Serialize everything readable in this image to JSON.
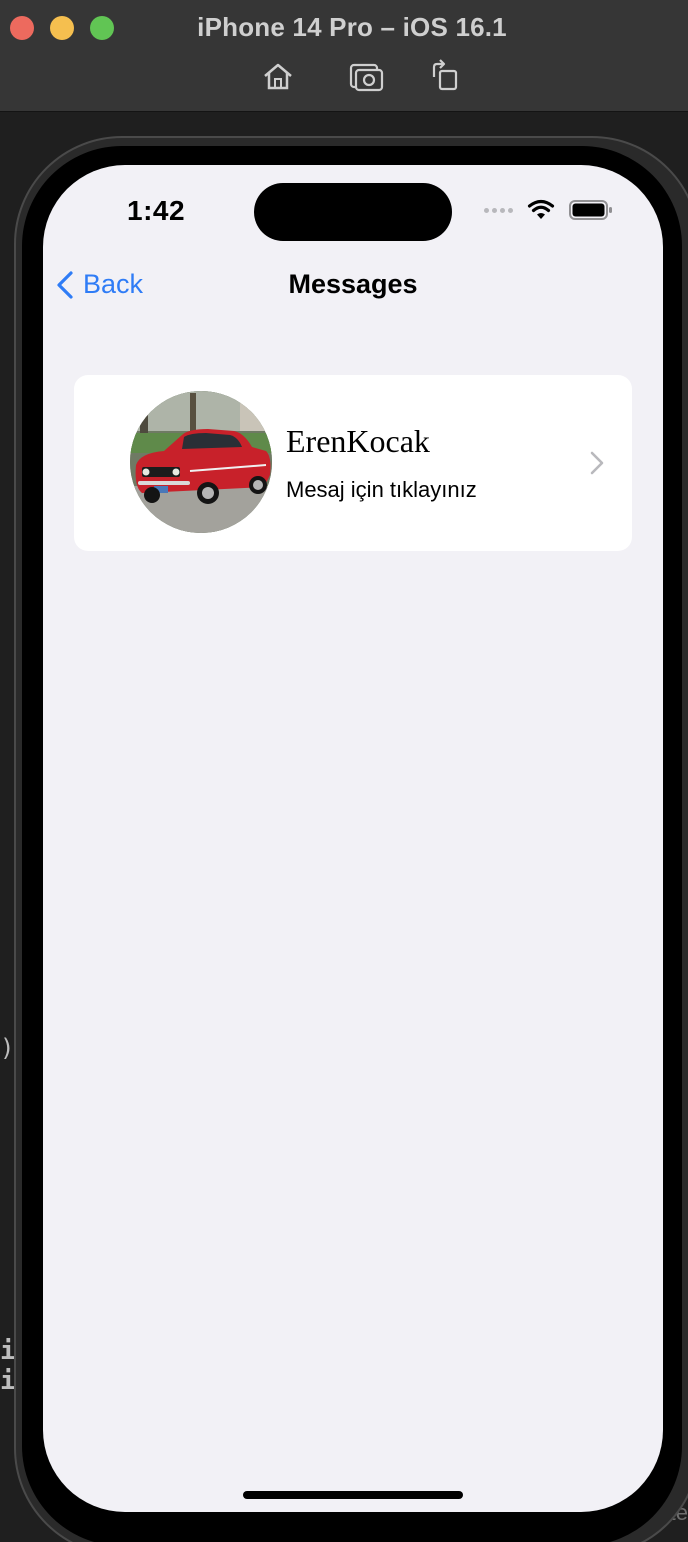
{
  "window": {
    "title": "iPhone 14 Pro – iOS 16.1",
    "controls": [
      "close",
      "minimize",
      "zoom"
    ],
    "toolbar": [
      {
        "name": "home-icon"
      },
      {
        "name": "screenshot-icon"
      },
      {
        "name": "rotate-icon"
      }
    ]
  },
  "background_fragments": {
    "paren": ")",
    "line1": "i",
    "line2": "i",
    "filter": "Filte"
  },
  "status_bar": {
    "time": "1:42",
    "icons": [
      "cellular-icon",
      "wifi-icon",
      "battery-icon"
    ]
  },
  "nav": {
    "back_label": "Back",
    "title": "Messages"
  },
  "messages": [
    {
      "name": "ErenKocak",
      "subtitle": "Mesaj için tıklayınız",
      "avatar": "red-car-photo"
    }
  ],
  "colors": {
    "accent": "#2f7cf6",
    "screen_background": "#f2f1f6",
    "cell_background": "#ffffff",
    "titlebar": "#363636"
  }
}
